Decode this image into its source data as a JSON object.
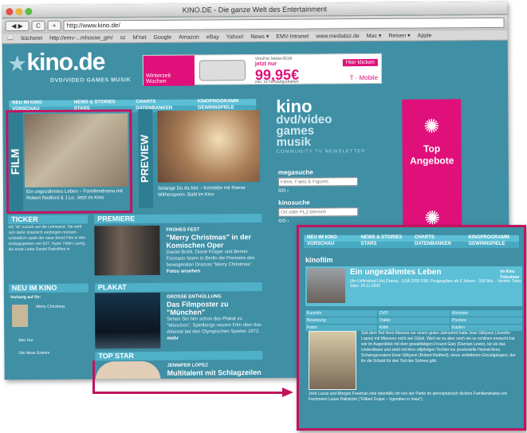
{
  "window": {
    "title": "KINO.DE - Die ganze Welt des Entertainment",
    "url": "http://www.kino.de/"
  },
  "toolbar": {
    "back": "◀",
    "forward": "▶",
    "reload": "C",
    "add": "+"
  },
  "bookmarks": [
    "bücherei",
    "http://emv-...mhouse_gm/",
    "sz",
    "M'net",
    "Google",
    "Amazon",
    "eBay",
    "Yahoo!",
    "News ▾",
    "EMV-Intranet",
    "www.mediabiz.de",
    "Mac ▾",
    "Reisen ▾",
    "Apple"
  ],
  "logo": {
    "text": "kino.de",
    "sub": "DVD/VIDEO GAMES MUSIK"
  },
  "banner": {
    "left": "Winterzeit Wochen",
    "model": "VirtuPac Nokia 6610i",
    "price": "99,95€",
    "price_note": "jetzt nur",
    "note": "inkl. 16 % Startguthaben",
    "cta": "Hier klicken",
    "brand": "T · Mobile"
  },
  "nav": {
    "row1": [
      "NEU IM KINO",
      "NEWS & STORIES",
      "CHARTS",
      "KINOPROGRAMM"
    ],
    "row2": [
      "VORSCHAU",
      "STARS",
      "DATENBANKEN",
      "GEWINNSPIELE"
    ]
  },
  "film": {
    "label": "FILM",
    "caption": "Ein ungezähmtes Leben – Familiendrama mit Robert Redford & J.Lo. Jetzt im Kino"
  },
  "preview": {
    "label": "PREVIEW",
    "caption": "Solange Du da bist – Komödie mit Reese Witherspoon. Bald im Kino"
  },
  "kino_right": {
    "big": "kino",
    "med1": "dvd/video",
    "med2": "games",
    "med3": "musik",
    "sub": "COMMUNITY  TV  NEWSLETTER"
  },
  "search1": {
    "title": "megasuche",
    "placeholder": "Filme, Fakts & Figures",
    "go": "GO ›"
  },
  "search2": {
    "title": "kinosuche",
    "placeholder": "Ort oder PLZ-Bereich",
    "go": "GO ›"
  },
  "pinkad": {
    "line1": "Top",
    "line2": "Angebote"
  },
  "ticker": {
    "head": "TICKER",
    "text": "Als \"M\" zurück auf die Leinwand. Sie wird sich dafür drastisch verjüngen müssen - schließlich spielt der neue Bond-Film in den Anfangsjahren von 007. Hype: Hafin Laung, die erste Liebe Daniel Radcliffes in"
  },
  "neu": {
    "head": "NEU IM KINO",
    "sub": "Vorhang auf für:",
    "items": [
      "Merry Christmas",
      "Ben Hur",
      "Die Neue Gramm"
    ]
  },
  "premiere": {
    "head": "PREMIERE",
    "kick": "FROHES FEST",
    "title": "\"Merry Christmas\" in der Komischen Oper",
    "text": "Daniel Brühl, Diane Krüger und Benno Fürmann feiern in Berlin die Premiere des bewegenden Dramas \"Merry Christmas\".",
    "more": "Fotos ansehen"
  },
  "plakat": {
    "head": "PLAKAT",
    "kick": "GROSSE ENTHÜLLUNG",
    "title": "Das Filmposter zu \"München\"",
    "text": "Sehen Sie hier schon das Plakat zu \"München\", Spielbergs neuem Film über das Attentat bei den Olympischen Spielen 1972.",
    "more": "mehr"
  },
  "topstar": {
    "head": "TOP STAR",
    "kick": "JENNIFER LOPEZ",
    "title": "Multitalent mit Schlagzeilen"
  },
  "zoom": {
    "knf": "kinofilm",
    "movie": "Ein ungezähmtes Leben",
    "info": "(An Unfinished Life) Drama · USA 2005 FSK: Freigegeben ab 6 Jahren · 108 Min. · Verleih: Tobis Start: 24.11.2005",
    "links": [
      "Im Kino",
      "Fotoshow"
    ],
    "grid": [
      "Kurzinfo",
      "DVD",
      "Kinostart",
      "Besetzung",
      "Trailer",
      "Preview",
      "Fotos",
      "Kritik",
      "Kaufen"
    ],
    "text": "Seit dem Tod ihres Mannes vor einem guten Jahrzehnt hatte Jean Gilkyson (Jennifer Lopez) mit Männern nicht viel Glück. Weil sie es aber noch nie so schlimm erwischt hat wie im Augenblick mit dem gewalttätigen Freund Gary (Damian Lewis), tut sie das Undenkbare und zieht mit ihrer elfjährigen Tochter ins provinzielle Heimat ihres Schwiegervaters Einar Gilkyson (Robert Redford), eines verbitterten Einzelgängers, der ihr die Schuld für den Tod des Sohnes gibt.",
    "foot": "Josh Lucas und Morgan Freeman sind ebenfalls mit von der Partie im atmosphärisch dichten Familiendrama von Fachmann Lasse Hallström (\"Gilbert Grape – Irgendwo in Iowa\")."
  }
}
